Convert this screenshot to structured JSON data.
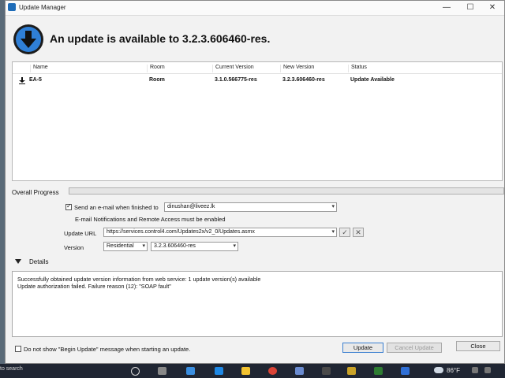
{
  "window": {
    "title": "Update Manager",
    "controls": {
      "minimize": "—",
      "maximize": "☐",
      "close": "✕"
    }
  },
  "header": {
    "message": "An update is available to 3.2.3.606460-res."
  },
  "grid": {
    "columns": [
      "Name",
      "Room",
      "Current Version",
      "New Version",
      "Status"
    ],
    "rows": [
      {
        "name": "EA-5",
        "room": "Room",
        "current_version": "3.1.0.566775-res",
        "new_version": "3.2.3.606460-res",
        "status": "Update Available"
      }
    ]
  },
  "progress": {
    "label": "Overall Progress",
    "value": 0
  },
  "email": {
    "checkbox_label": "Send an e-mail when finished to",
    "checked": true,
    "address": "dinushan@liveez.lk",
    "note": "E-mail Notifications and Remote Access must be enabled"
  },
  "update_url": {
    "label": "Update URL",
    "value": "https://services.control4.com/Updates2x/v2_0/Updates.asmx"
  },
  "version": {
    "label": "Version",
    "type_value": "Residential",
    "version_value": "3.2.3.606460-res"
  },
  "details": {
    "label": "Details",
    "lines": [
      "Successfully obtained update version information from web service: 1 update version(s) available",
      "Update authorization failed. Failure reason (12): \"SOAP fault\""
    ]
  },
  "footer": {
    "checkbox_label": "Do not show \"Begin Update\" message when starting an update.",
    "update_button": "Update",
    "cancel_button": "Cancel Update",
    "close_button": "Close"
  },
  "taskbar": {
    "search_text": "to search",
    "temperature": "86°F"
  },
  "colors": {
    "accent": "#3b7fd0",
    "taskbar": "#202633"
  }
}
